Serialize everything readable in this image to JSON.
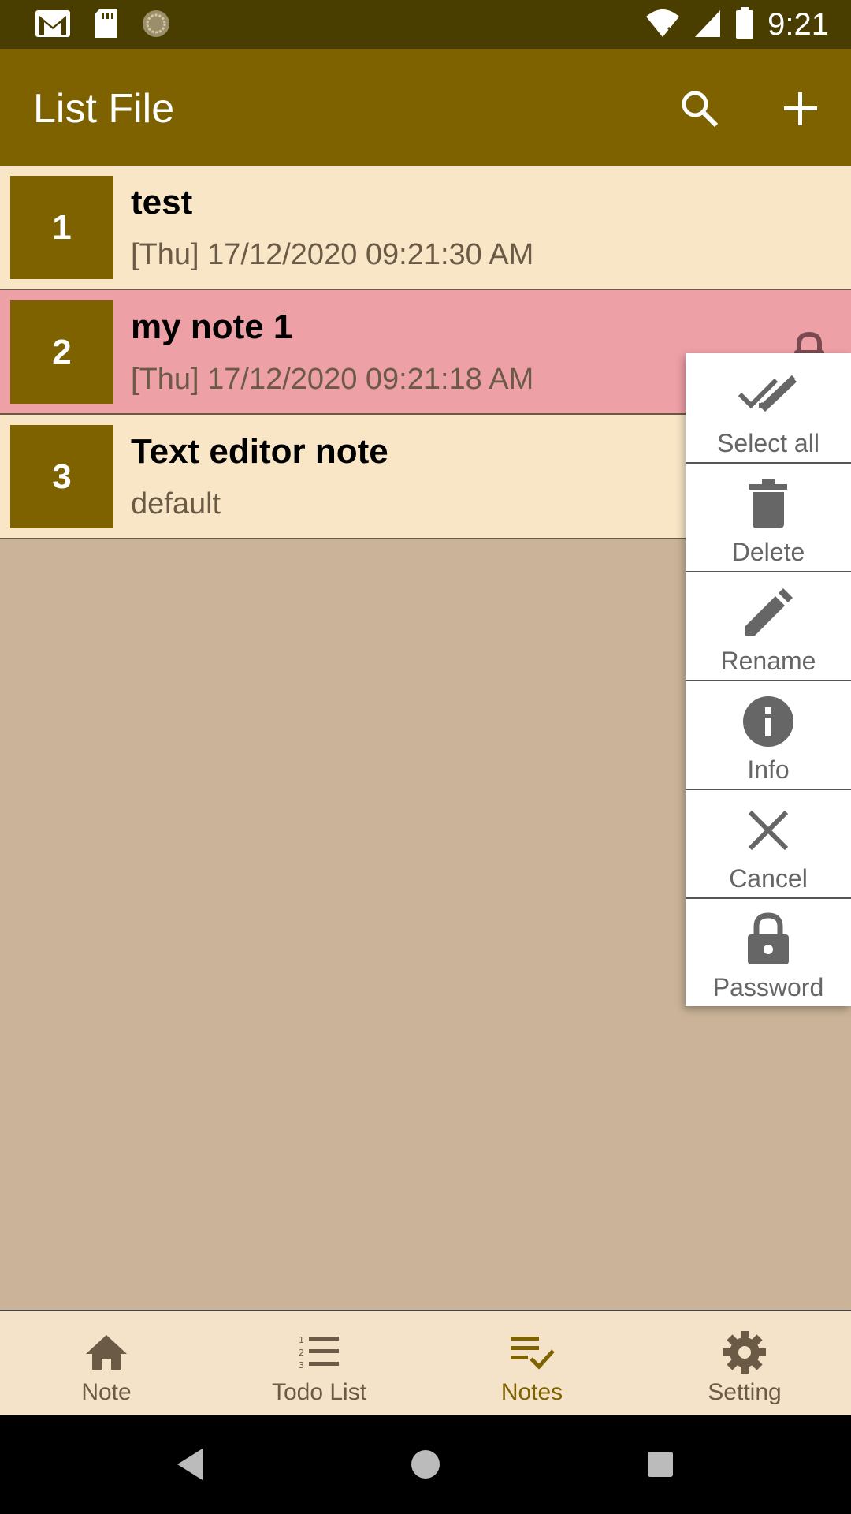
{
  "status_bar": {
    "time": "9:21"
  },
  "app_bar": {
    "title": "List File",
    "search_icon": "search-icon",
    "add_icon": "plus-icon"
  },
  "notes": [
    {
      "number": "1",
      "title": "test",
      "subtitle": "[Thu] 17/12/2020 09:21:30 AM",
      "selected": false
    },
    {
      "number": "2",
      "title": "my note 1",
      "subtitle": "[Thu] 17/12/2020 09:21:18 AM",
      "selected": true,
      "locked": true
    },
    {
      "number": "3",
      "title": "Text editor note",
      "subtitle": "default",
      "selected": false
    }
  ],
  "context_menu": {
    "items": [
      {
        "label": "Select all",
        "icon": "double-check-icon"
      },
      {
        "label": "Delete",
        "icon": "trash-icon"
      },
      {
        "label": "Rename",
        "icon": "pencil-icon"
      },
      {
        "label": "Info",
        "icon": "info-icon"
      },
      {
        "label": "Cancel",
        "icon": "close-icon"
      },
      {
        "label": "Password",
        "icon": "lock-icon"
      }
    ]
  },
  "bottom_nav": {
    "items": [
      {
        "label": "Note",
        "icon": "home-icon",
        "active": false
      },
      {
        "label": "Todo List",
        "icon": "numbered-list-icon",
        "active": false
      },
      {
        "label": "Notes",
        "icon": "checklist-icon",
        "active": true
      },
      {
        "label": "Setting",
        "icon": "gear-icon",
        "active": false
      }
    ]
  },
  "colors": {
    "status_bar": "#4a3d00",
    "app_bar": "#7e6200",
    "list_item_bg": "#f8e6c7",
    "selected_item_bg": "#eea0a7",
    "body_bg": "#cab398",
    "bottom_nav_bg": "#f4e3c9",
    "active_nav": "#7e6200"
  }
}
